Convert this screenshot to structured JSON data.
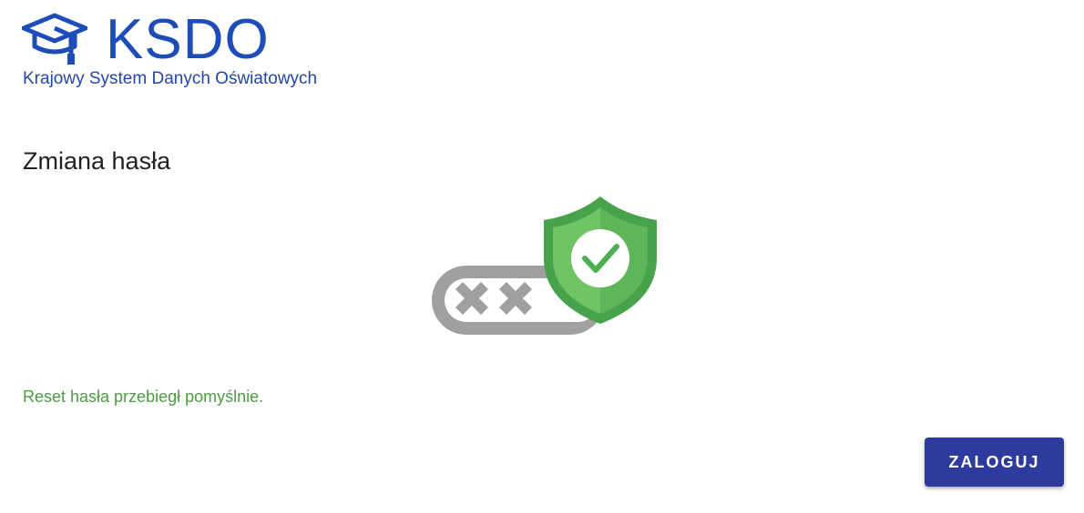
{
  "header": {
    "logo_title": "KSDO",
    "logo_subtitle": "Krajowy System Danych Oświatowych",
    "logo_icon": "graduation-cap-icon"
  },
  "main": {
    "title": "Zmiana hasła",
    "illustration_icon": "password-shield-check-icon",
    "message": "Reset hasła przebiegł pomyślnie.",
    "login_label": "ZALOGUJ"
  },
  "colors": {
    "brand": "#1d4db8",
    "button": "#2e3b9e",
    "success": "#4f9a45",
    "shield": "#4caf50"
  }
}
